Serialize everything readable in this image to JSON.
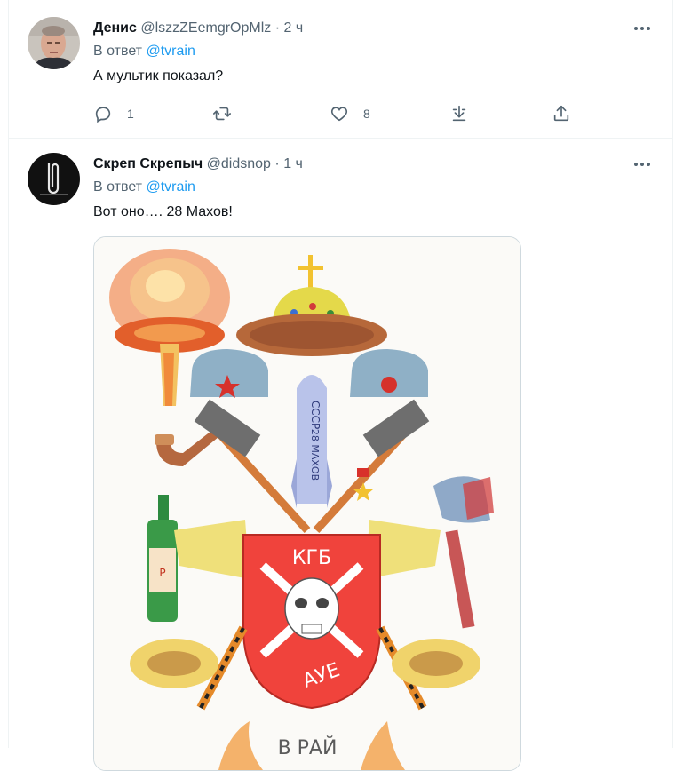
{
  "tweets": [
    {
      "name": "Денис",
      "handle": "@lszzZEemgrOpMlz",
      "separator": "·",
      "time": "2 ч",
      "reply_prefix": "В ответ",
      "reply_to": "@tvrain",
      "text": "А мультик показал?",
      "stats": {
        "replies": "1",
        "retweets": "",
        "likes": "8"
      }
    },
    {
      "name": "Скреп Скрепыч",
      "handle": "@didsnop",
      "separator": "·",
      "time": "1 ч",
      "reply_prefix": "В ответ",
      "reply_to": "@tvrain",
      "text": "Вот оно…. 28 Махов!",
      "image": {
        "shield_text": "КГБ",
        "shield_bottom_text": "АУЕ",
        "rocket_text": "СССР 28 МАХОВ",
        "bottom_text": "В РАЙ"
      }
    }
  ],
  "colors": {
    "link": "#1d9bf0",
    "muted": "#536471",
    "text": "#0f1419",
    "border": "#eff3f4"
  },
  "icons": [
    "more-icon",
    "reply-icon",
    "retweet-icon",
    "like-icon",
    "download-icon",
    "share-icon"
  ]
}
